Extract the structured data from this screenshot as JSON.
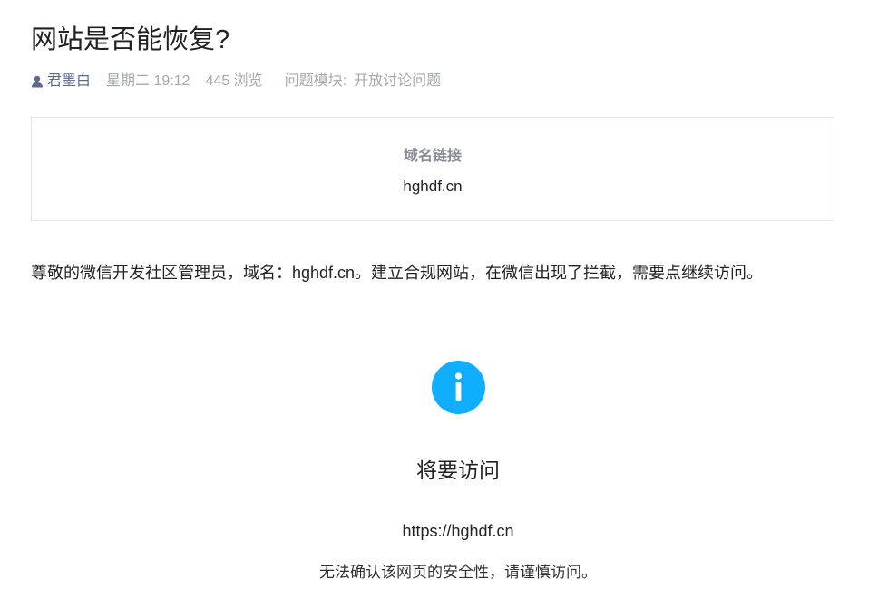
{
  "post": {
    "title": "网站是否能恢复?",
    "author": "君墨白",
    "time": "星期二 19:12",
    "views": "445 浏览",
    "module_label": "问题模块:",
    "module_value": "开放讨论问题"
  },
  "link_card": {
    "title": "域名链接",
    "link": "hghdf.cn"
  },
  "body": {
    "text": "尊敬的微信开发社区管理员，域名：hghdf.cn。建立合规网站，在微信出现了拦截，需要点继续访问。"
  },
  "warning": {
    "icon": "info-icon",
    "icon_color": "#10aeff",
    "title": "将要访问",
    "url": "https://hghdf.cn",
    "note": "无法确认该网页的安全性，请谨慎访问。"
  }
}
